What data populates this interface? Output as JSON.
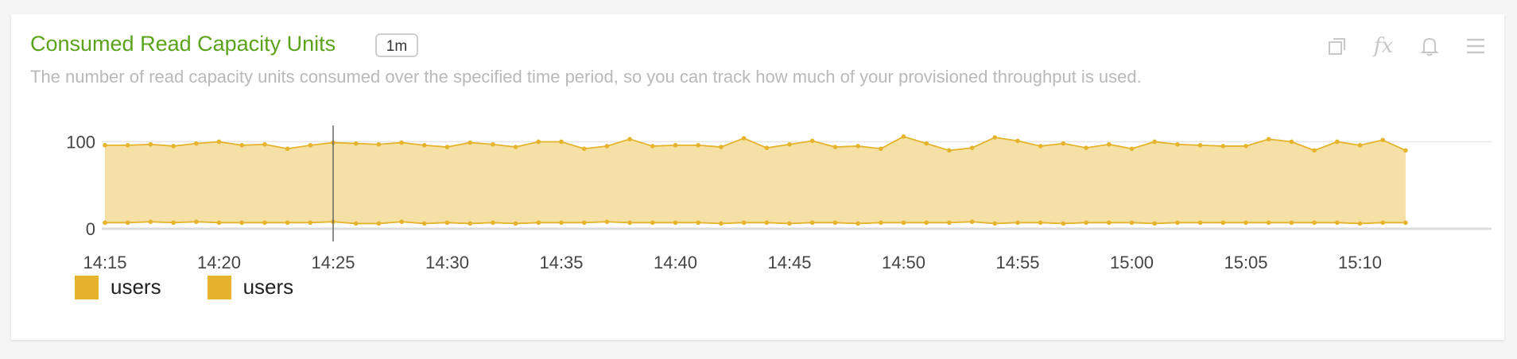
{
  "panel": {
    "title": "Consumed Read Capacity Units",
    "interval_badge": "1m",
    "description": "The number of read capacity units consumed over the specified time period, so you can track how much of your provisioned throughput is used.",
    "toolbar": {
      "copy_icon": "copy-icon",
      "formula_icon": "fx",
      "alert_icon": "bell-icon",
      "menu_icon": "menu-icon"
    },
    "colors": {
      "title": "#5aa31a",
      "series_line": "#e5b32c",
      "series_fill": "#f5e0a6",
      "legend_swatch": "#e5b32c"
    }
  },
  "chart_data": {
    "type": "area",
    "title": "",
    "xlabel": "",
    "ylabel": "",
    "x_ticks": [
      "14:15",
      "14:20",
      "14:25",
      "14:30",
      "14:35",
      "14:40",
      "14:45",
      "14:50",
      "14:55",
      "15:00",
      "15:05",
      "15:10"
    ],
    "y_ticks": [
      0,
      100
    ],
    "ylim": [
      0,
      105
    ],
    "x_start": "14:15",
    "x_step_minutes": 1,
    "cursor_x": "14:25",
    "grid": true,
    "legend_position": "bottom-left",
    "series": [
      {
        "name": "users",
        "values": [
          96,
          96,
          97,
          95,
          98,
          100,
          96,
          97,
          92,
          96,
          99,
          98,
          97,
          99,
          96,
          94,
          99,
          97,
          94,
          100,
          100,
          92,
          95,
          103,
          95,
          96,
          96,
          94,
          104,
          93,
          97,
          101,
          94,
          95,
          92,
          106,
          98,
          90,
          93,
          105,
          101,
          95,
          98,
          93,
          97,
          92,
          100,
          97,
          96,
          95,
          95,
          103,
          100,
          90,
          100,
          96,
          102,
          90
        ]
      },
      {
        "name": "users",
        "values": [
          7,
          7,
          8,
          7,
          8,
          7,
          7,
          7,
          7,
          7,
          8,
          6,
          6,
          8,
          6,
          7,
          6,
          7,
          6,
          7,
          7,
          7,
          8,
          7,
          7,
          7,
          7,
          6,
          7,
          7,
          6,
          7,
          7,
          6,
          7,
          7,
          7,
          7,
          8,
          6,
          7,
          7,
          6,
          7,
          7,
          7,
          6,
          7,
          7,
          7,
          7,
          7,
          7,
          7,
          7,
          6,
          7,
          7
        ]
      }
    ],
    "legend": [
      {
        "label": "users",
        "color": "#e5b32c"
      },
      {
        "label": "users",
        "color": "#e5b32c"
      }
    ]
  }
}
